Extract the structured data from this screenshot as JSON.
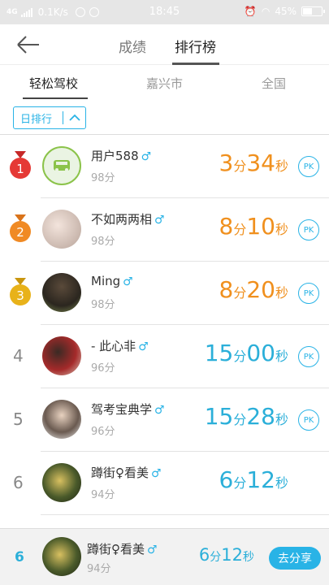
{
  "status_bar": {
    "network": "4G",
    "speed": "0.1K/s",
    "time": "18:45",
    "battery": "45%"
  },
  "header": {
    "tabs": [
      {
        "label": "成绩",
        "active": false
      },
      {
        "label": "排行榜",
        "active": true
      }
    ]
  },
  "scope_tabs": [
    {
      "label": "轻松驾校",
      "active": true
    },
    {
      "label": "嘉兴市",
      "active": false
    },
    {
      "label": "全国",
      "active": false
    }
  ],
  "filter": {
    "label": "日排行"
  },
  "rows": [
    {
      "rank": "1",
      "name": "用户588",
      "gender": "♂",
      "score": "98分",
      "min": "3",
      "min_unit": "分",
      "sec": "34",
      "sec_unit": "秒",
      "pk": "PK"
    },
    {
      "rank": "2",
      "name": "不如两两相",
      "gender": "♂",
      "score": "98分",
      "min": "8",
      "min_unit": "分",
      "sec": "10",
      "sec_unit": "秒",
      "pk": "PK"
    },
    {
      "rank": "3",
      "name": "Ming",
      "gender": "♂",
      "score": "98分",
      "min": "8",
      "min_unit": "分",
      "sec": "20",
      "sec_unit": "秒",
      "pk": "PK"
    },
    {
      "rank": "4",
      "name": "- 此心非",
      "gender": "♂",
      "score": "96分",
      "min": "15",
      "min_unit": "分",
      "sec": "00",
      "sec_unit": "秒",
      "pk": "PK"
    },
    {
      "rank": "5",
      "name": "驾考宝典学",
      "gender": "♂",
      "score": "96分",
      "min": "15",
      "min_unit": "分",
      "sec": "28",
      "sec_unit": "秒",
      "pk": "PK"
    },
    {
      "rank": "6",
      "name": "蹲街♀看美",
      "gender": "♂",
      "score": "94分",
      "min": "6",
      "min_unit": "分",
      "sec": "12",
      "sec_unit": "秒"
    }
  ],
  "self": {
    "rank": "6",
    "name": "蹲街♀看美",
    "gender": "♂",
    "score": "94分",
    "min": "6",
    "min_unit": "分",
    "sec": "12",
    "sec_unit": "秒",
    "share_label": "去分享"
  },
  "colors": {
    "accent": "#29b3e6",
    "top3_time": "#f0901e",
    "gold": "#e8b21a",
    "red_medal": "#e53935",
    "orange_medal": "#f08a24"
  }
}
